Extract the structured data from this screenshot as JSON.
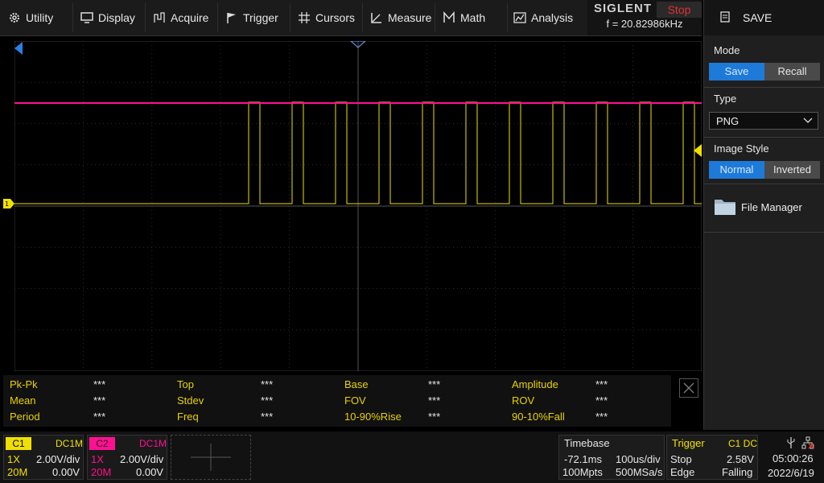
{
  "menu": [
    {
      "label": "Utility",
      "icon": "gear-icon"
    },
    {
      "label": "Display",
      "icon": "monitor-icon"
    },
    {
      "label": "Acquire",
      "icon": "acquire-icon"
    },
    {
      "label": "Trigger",
      "icon": "flag-icon"
    },
    {
      "label": "Cursors",
      "icon": "cursor-cross-icon"
    },
    {
      "label": "Measure",
      "icon": "measure-icon"
    },
    {
      "label": "Math",
      "icon": "math-icon"
    },
    {
      "label": "Analysis",
      "icon": "analysis-icon"
    }
  ],
  "brand": {
    "name": "SIGLENT",
    "status": "Stop",
    "frequency": "f = 20.82986kHz"
  },
  "panel": {
    "title": "SAVE",
    "mode": {
      "label": "Mode",
      "options": [
        "Save",
        "Recall"
      ],
      "selected": "Save"
    },
    "type": {
      "label": "Type",
      "value": "PNG"
    },
    "image_style": {
      "label": "Image Style",
      "options": [
        "Normal",
        "Inverted"
      ],
      "selected": "Normal"
    },
    "file_manager": "File Manager"
  },
  "measurements": [
    [
      {
        "label": "Pk-Pk",
        "value": "***"
      },
      {
        "label": "Top",
        "value": "***"
      },
      {
        "label": "Base",
        "value": "***"
      },
      {
        "label": "Amplitude",
        "value": "***"
      }
    ],
    [
      {
        "label": "Mean",
        "value": "***"
      },
      {
        "label": "Stdev",
        "value": "***"
      },
      {
        "label": "FOV",
        "value": "***"
      },
      {
        "label": "ROV",
        "value": "***"
      }
    ],
    [
      {
        "label": "Period",
        "value": "***"
      },
      {
        "label": "Freq",
        "value": "***"
      },
      {
        "label": "10-90%Rise",
        "value": "***"
      },
      {
        "label": "90-10%Fall",
        "value": "***"
      }
    ]
  ],
  "channels": [
    {
      "name": "C1",
      "coupling": "DC1M",
      "probe": "1X",
      "scale": "2.00V/div",
      "bw": "20M",
      "offset": "0.00V",
      "color": "#f0e000"
    },
    {
      "name": "C2",
      "coupling": "DC1M",
      "probe": "1X",
      "scale": "2.00V/div",
      "bw": "20M",
      "offset": "0.00V",
      "color": "#ff1090"
    }
  ],
  "timebase": {
    "label": "Timebase",
    "delay": "-72.1ms",
    "scale": "100us/div",
    "memory": "100Mpts",
    "rate": "500MSa/s"
  },
  "trigger": {
    "label": "Trigger",
    "source": "C1 DC",
    "state": "Stop",
    "level": "2.58V",
    "type": "Edge",
    "slope": "Falling"
  },
  "clock": {
    "time": "05:00:26",
    "date": "2022/6/19"
  },
  "colors": {
    "ch1": "#f0e000",
    "ch2": "#ff1090",
    "accent": "#1e7ad8"
  }
}
